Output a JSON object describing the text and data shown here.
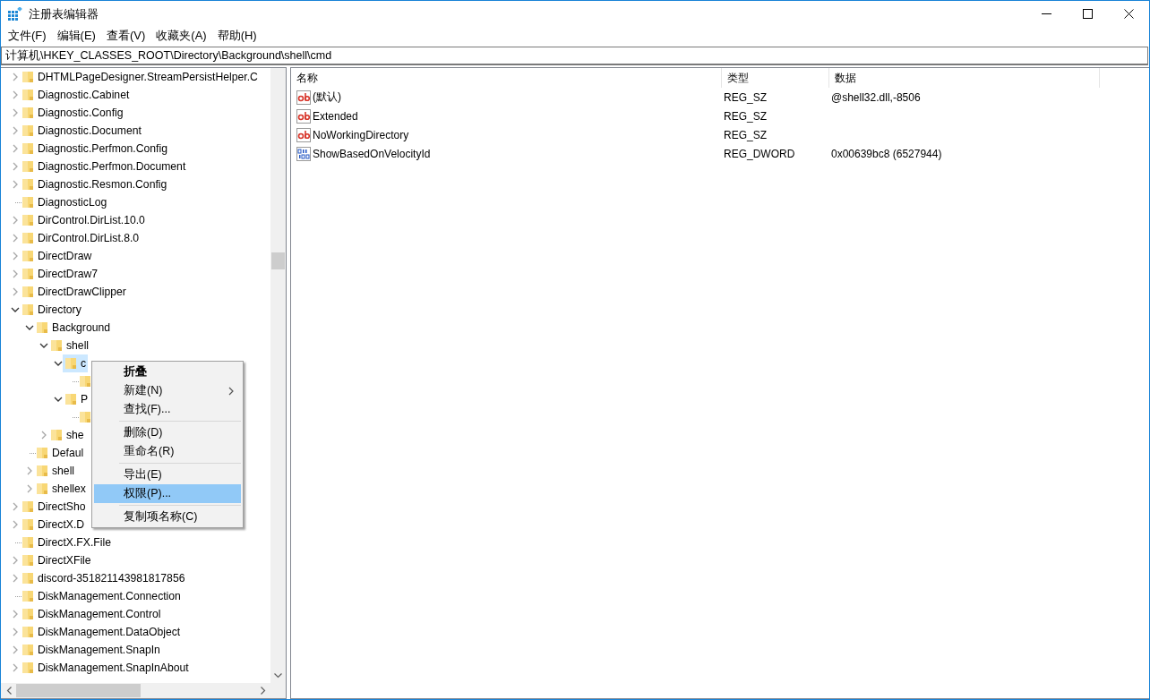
{
  "window": {
    "title": "注册表编辑器"
  },
  "menu_bar": [
    "文件(F)",
    "编辑(E)",
    "查看(V)",
    "收藏夹(A)",
    "帮助(H)"
  ],
  "address_bar": {
    "value": "计算机\\HKEY_CLASSES_ROOT\\Directory\\Background\\shell\\cmd"
  },
  "tree": [
    {
      "label": "DHTMLPageDesigner.StreamPersistHelper.C",
      "kind": "branch",
      "expanded": false,
      "selected": false
    },
    {
      "label": "Diagnostic.Cabinet",
      "kind": "branch",
      "expanded": false,
      "selected": false
    },
    {
      "label": "Diagnostic.Config",
      "kind": "branch",
      "expanded": false,
      "selected": false
    },
    {
      "label": "Diagnostic.Document",
      "kind": "branch",
      "expanded": false,
      "selected": false
    },
    {
      "label": "Diagnostic.Perfmon.Config",
      "kind": "branch",
      "expanded": false,
      "selected": false
    },
    {
      "label": "Diagnostic.Perfmon.Document",
      "kind": "branch",
      "expanded": false,
      "selected": false
    },
    {
      "label": "Diagnostic.Resmon.Config",
      "kind": "branch",
      "expanded": false,
      "selected": false
    },
    {
      "label": "DiagnosticLog",
      "kind": "leaf",
      "selected": false
    },
    {
      "label": "DirControl.DirList.10.0",
      "kind": "branch",
      "expanded": false,
      "selected": false
    },
    {
      "label": "DirControl.DirList.8.0",
      "kind": "branch",
      "expanded": false,
      "selected": false
    },
    {
      "label": "DirectDraw",
      "kind": "branch",
      "expanded": false,
      "selected": false
    },
    {
      "label": "DirectDraw7",
      "kind": "branch",
      "expanded": false,
      "selected": false
    },
    {
      "label": "DirectDrawClipper",
      "kind": "branch",
      "expanded": false,
      "selected": false
    },
    {
      "label": "Directory",
      "kind": "branch",
      "expanded": true,
      "selected": false,
      "children": [
        {
          "label": "Background",
          "kind": "branch",
          "expanded": true,
          "selected": false,
          "children": [
            {
              "label": "shell",
              "kind": "branch",
              "expanded": true,
              "selected": false,
              "children": [
                {
                  "label": "c",
                  "kind": "branch",
                  "expanded": true,
                  "selected": true,
                  "children": [
                    {
                      "kind": "leaf",
                      "selected": false
                    }
                  ]
                },
                {
                  "label": "P",
                  "kind": "branch",
                  "expanded": true,
                  "selected": false,
                  "children": [
                    {
                      "kind": "leaf",
                      "selected": false
                    }
                  ]
                }
              ]
            },
            {
              "label": "she",
              "kind": "branch",
              "expanded": false,
              "selected": false
            }
          ]
        },
        {
          "label": "Defaul",
          "kind": "leaf",
          "selected": false
        },
        {
          "label": "shell",
          "kind": "branch",
          "expanded": false,
          "selected": false
        },
        {
          "label": "shellex",
          "kind": "branch",
          "expanded": false,
          "selected": false
        }
      ]
    },
    {
      "label": "DirectSho",
      "kind": "branch",
      "expanded": false,
      "selected": false
    },
    {
      "label": "DirectX.D",
      "kind": "branch",
      "expanded": false,
      "selected": false
    },
    {
      "label": "DirectX.FX.File",
      "kind": "leaf",
      "selected": false
    },
    {
      "label": "DirectXFile",
      "kind": "branch",
      "expanded": false,
      "selected": false
    },
    {
      "label": "discord-351821143981817856",
      "kind": "branch",
      "expanded": false,
      "selected": false
    },
    {
      "label": "DiskManagement.Connection",
      "kind": "leaf",
      "selected": false
    },
    {
      "label": "DiskManagement.Control",
      "kind": "branch",
      "expanded": false,
      "selected": false
    },
    {
      "label": "DiskManagement.DataObject",
      "kind": "branch",
      "expanded": false,
      "selected": false
    },
    {
      "label": "DiskManagement.SnapIn",
      "kind": "branch",
      "expanded": false,
      "selected": false
    },
    {
      "label": "DiskManagement.SnapInAbout",
      "kind": "branch",
      "expanded": false,
      "selected": false
    }
  ],
  "values_list": {
    "columns": [
      "名称",
      "类型",
      "数据"
    ],
    "rows": [
      {
        "kind": "string",
        "name": "(默认)",
        "type": "REG_SZ",
        "data": "@shell32.dll,-8506"
      },
      {
        "kind": "string",
        "name": "Extended",
        "type": "REG_SZ"
      },
      {
        "kind": "string",
        "name": "NoWorkingDirectory",
        "type": "REG_SZ"
      },
      {
        "kind": "binary",
        "name": "ShowBasedOnVelocityId",
        "type": "REG_DWORD",
        "data": "0x00639bc8 (6527944)"
      }
    ]
  },
  "context_menu": {
    "groups": [
      [
        {
          "label": "折叠",
          "bold": true,
          "submenu": false,
          "selected": false
        },
        {
          "label": "新建(N)",
          "bold": false,
          "submenu": true,
          "selected": false
        },
        {
          "label": "查找(F)...",
          "bold": false,
          "submenu": false,
          "selected": false
        }
      ],
      [
        {
          "label": "删除(D)",
          "bold": false,
          "submenu": false,
          "selected": false
        },
        {
          "label": "重命名(R)",
          "bold": false,
          "submenu": false,
          "selected": false
        }
      ],
      [
        {
          "label": "导出(E)",
          "bold": false,
          "submenu": false,
          "selected": false
        },
        {
          "label": "权限(P)...",
          "bold": false,
          "submenu": false,
          "selected": true
        }
      ],
      [
        {
          "label": "复制项名称(C)",
          "bold": false,
          "submenu": false,
          "selected": false
        }
      ]
    ]
  }
}
